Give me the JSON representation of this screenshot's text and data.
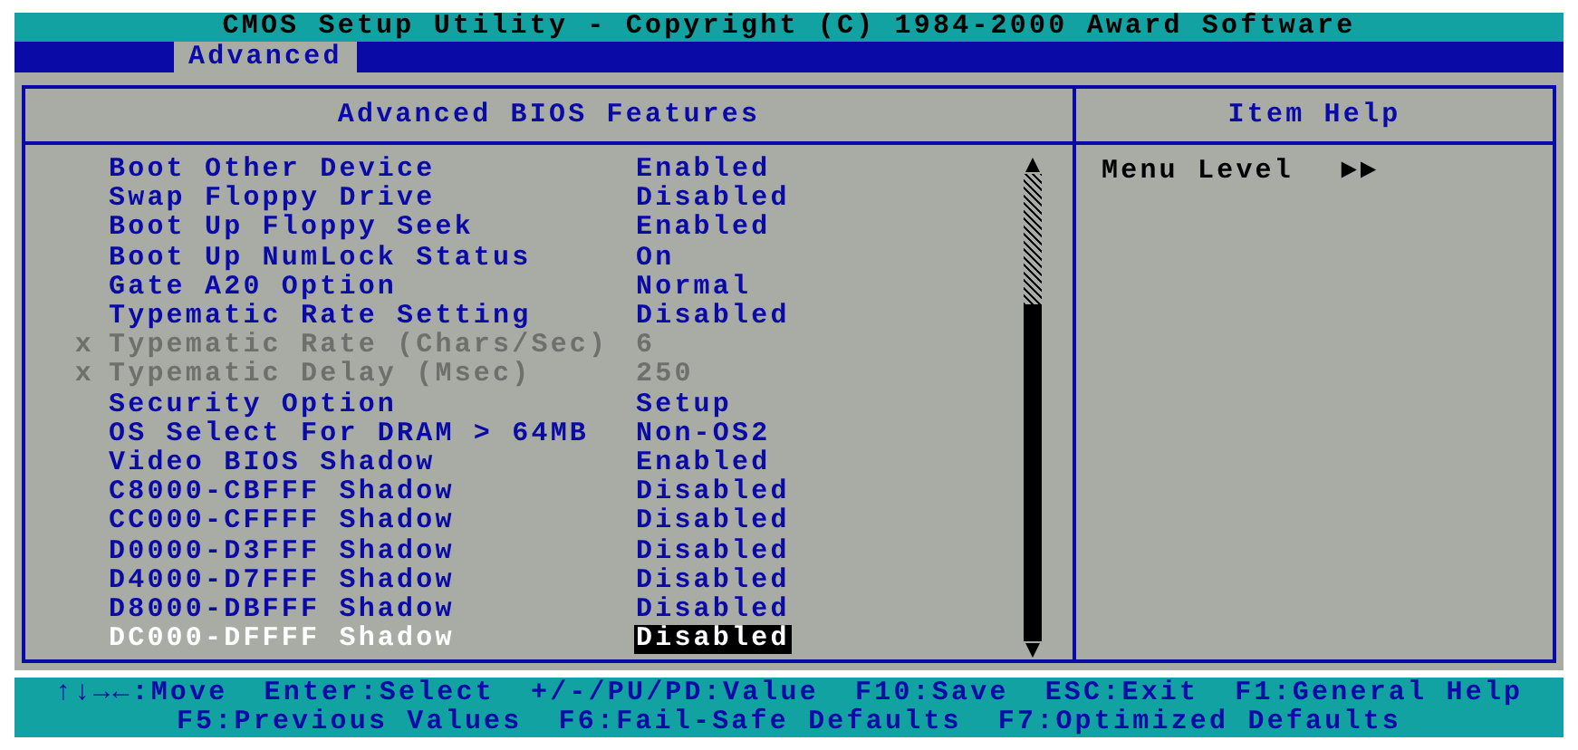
{
  "title": "CMOS Setup Utility - Copyright (C) 1984-2000 Award Software",
  "tabs": [
    {
      "label": "Advanced",
      "selected": true
    }
  ],
  "panel": {
    "title": "Advanced BIOS Features",
    "help_title": "Item Help",
    "help_label": "Menu Level",
    "help_value": "►►"
  },
  "items": [
    {
      "label": "Boot Other Device",
      "value": "Enabled",
      "disabled": false,
      "selected": false
    },
    {
      "label": "Swap Floppy Drive",
      "value": "Disabled",
      "disabled": false,
      "selected": false
    },
    {
      "label": "Boot Up Floppy Seek",
      "value": "Enabled",
      "disabled": false,
      "selected": false
    },
    {
      "label": "Boot Up NumLock Status",
      "value": "On",
      "disabled": false,
      "selected": false
    },
    {
      "label": "Gate A20 Option",
      "value": "Normal",
      "disabled": false,
      "selected": false
    },
    {
      "label": "Typematic Rate Setting",
      "value": "Disabled",
      "disabled": false,
      "selected": false
    },
    {
      "marker": "x",
      "label": "Typematic Rate (Chars/Sec)",
      "value": "6",
      "disabled": true,
      "selected": false
    },
    {
      "marker": "x",
      "label": "Typematic Delay (Msec)",
      "value": "250",
      "disabled": true,
      "selected": false
    },
    {
      "label": "Security Option",
      "value": "Setup",
      "disabled": false,
      "selected": false
    },
    {
      "label": "OS Select For DRAM > 64MB",
      "value": "Non-OS2",
      "disabled": false,
      "selected": false
    },
    {
      "label": "Video BIOS Shadow",
      "value": "Enabled",
      "disabled": false,
      "selected": false
    },
    {
      "label": "C8000-CBFFF Shadow",
      "value": "Disabled",
      "disabled": false,
      "selected": false
    },
    {
      "label": "CC000-CFFFF Shadow",
      "value": "Disabled",
      "disabled": false,
      "selected": false
    },
    {
      "label": "D0000-D3FFF Shadow",
      "value": "Disabled",
      "disabled": false,
      "selected": false
    },
    {
      "label": "D4000-D7FFF Shadow",
      "value": "Disabled",
      "disabled": false,
      "selected": false
    },
    {
      "label": "D8000-DBFFF Shadow",
      "value": "Disabled",
      "disabled": false,
      "selected": false
    },
    {
      "label": "DC000-DFFFF Shadow",
      "value": "Disabled",
      "disabled": false,
      "selected": true
    }
  ],
  "footer": [
    [
      "↑↓→←:Move",
      "Enter:Select",
      "+/-/PU/PD:Value",
      "F10:Save",
      "ESC:Exit",
      "F1:General Help"
    ],
    [
      "F5:Previous Values",
      "F6:Fail-Safe Defaults",
      "F7:Optimized Defaults"
    ]
  ]
}
